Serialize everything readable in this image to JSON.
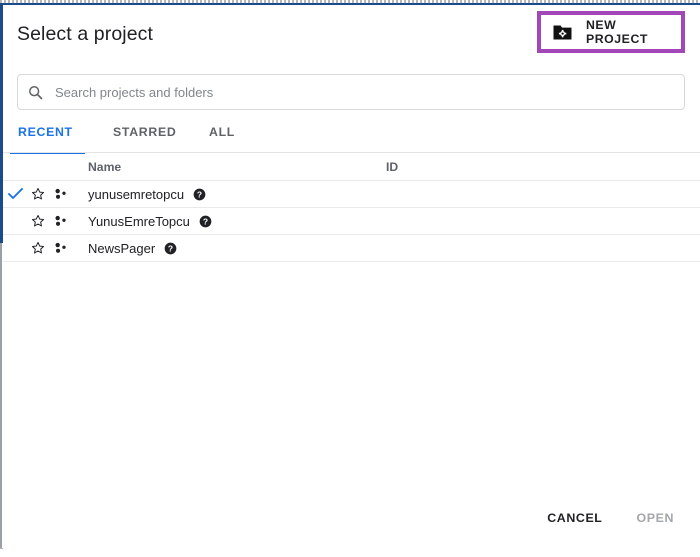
{
  "dialog": {
    "title": "Select a project",
    "new_project": {
      "label": "NEW PROJECT",
      "icon": "create-new-folder-icon",
      "highlight_color": "#a347b8"
    }
  },
  "search": {
    "placeholder": "Search projects and folders",
    "value": "",
    "icon": "search-icon"
  },
  "tabs": [
    {
      "label": "RECENT",
      "active": true
    },
    {
      "label": "STARRED",
      "active": false
    },
    {
      "label": "ALL",
      "active": false
    }
  ],
  "table": {
    "columns": [
      "Name",
      "ID"
    ],
    "rows": [
      {
        "selected": true,
        "starred": false,
        "star_icon": "star-outline-icon",
        "type_icon": "cloud-project-icon",
        "help_icon": "help-circle-icon",
        "name": "yunusemretopcu",
        "id": ""
      },
      {
        "selected": false,
        "starred": false,
        "star_icon": "star-outline-icon",
        "type_icon": "cloud-project-icon",
        "help_icon": "help-circle-icon",
        "name": "YunusEmreTopcu",
        "id": ""
      },
      {
        "selected": false,
        "starred": false,
        "star_icon": "star-outline-icon",
        "type_icon": "cloud-project-icon",
        "help_icon": "help-circle-icon",
        "name": "NewsPager",
        "id": ""
      }
    ]
  },
  "footer": {
    "cancel_label": "CANCEL",
    "open_label": "OPEN",
    "open_disabled": true
  },
  "colors": {
    "accent_blue": "#1a73e8",
    "highlight_purple": "#a347b8",
    "text_primary": "#202124",
    "text_secondary": "#5f6368"
  }
}
